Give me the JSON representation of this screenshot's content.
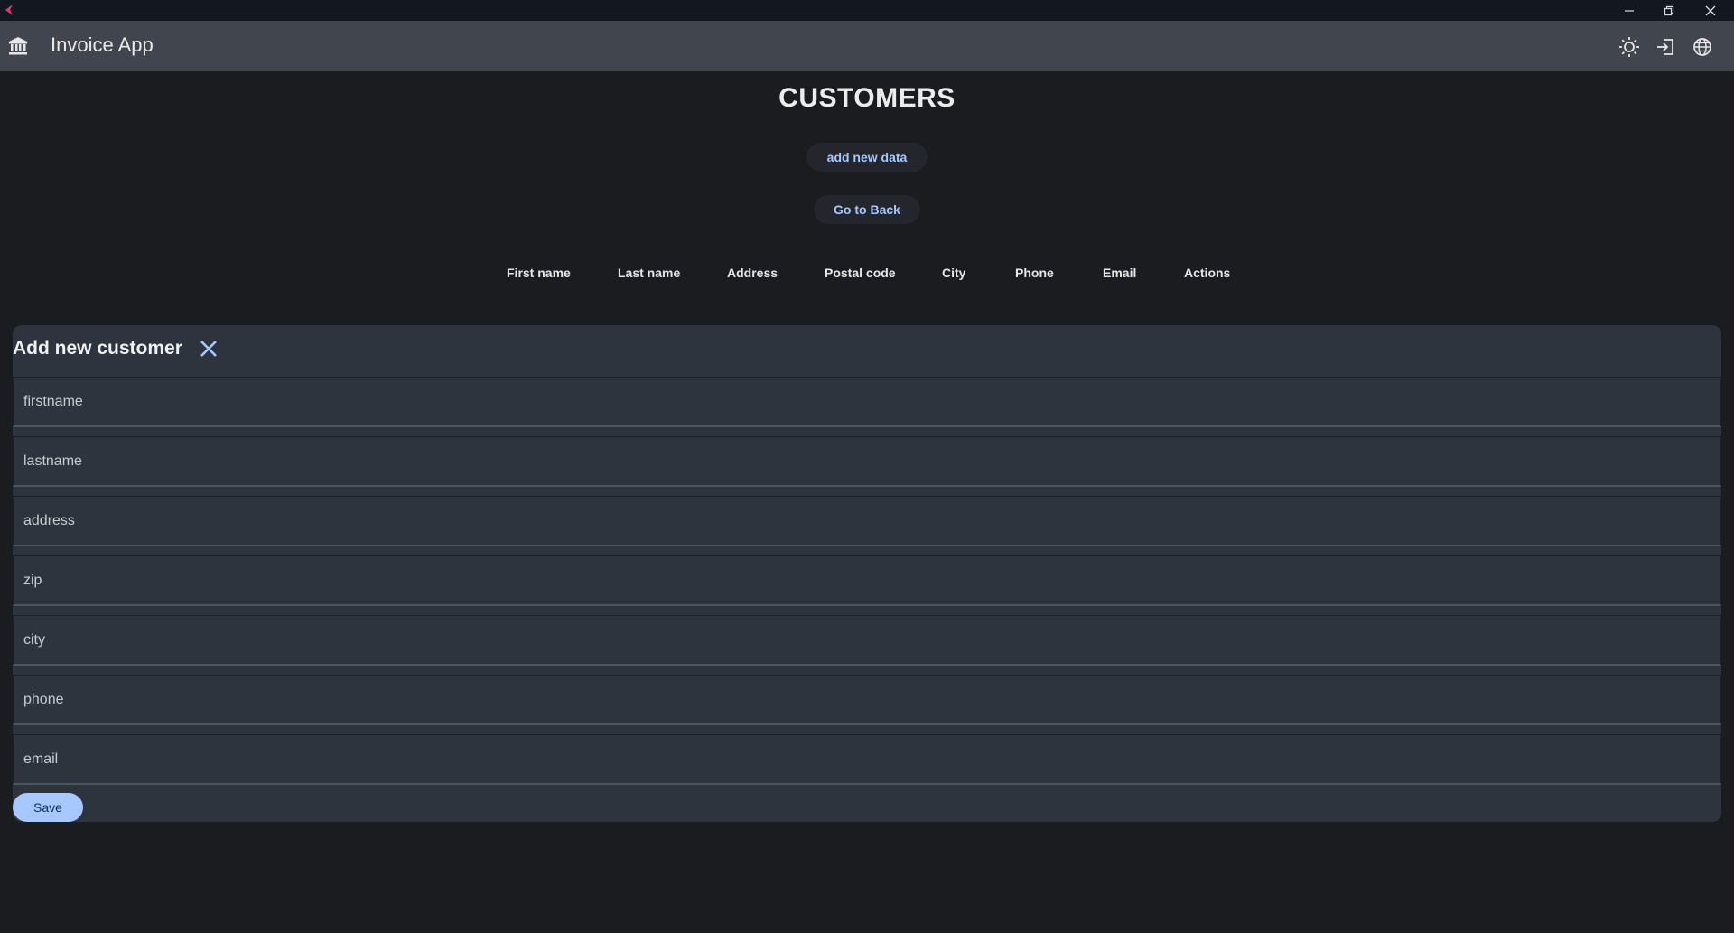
{
  "app": {
    "title": "Invoice App",
    "accent_color": "#a6c8ff",
    "header_icons": [
      "bank-icon",
      "sun-icon",
      "logout-icon",
      "globe-icon"
    ]
  },
  "window": {
    "controls": [
      "minimize-icon",
      "restore-icon",
      "close-icon"
    ]
  },
  "page": {
    "title": "CUSTOMERS",
    "add_button": "add new data",
    "back_button": "Go to Back"
  },
  "table": {
    "columns": [
      "First name",
      "Last name",
      "Address",
      "Postal code",
      "City",
      "Phone",
      "Email",
      "Actions"
    ]
  },
  "form": {
    "title": "Add new customer",
    "fields": [
      {
        "placeholder": "firstname",
        "value": ""
      },
      {
        "placeholder": "lastname",
        "value": ""
      },
      {
        "placeholder": "address",
        "value": ""
      },
      {
        "placeholder": "zip",
        "value": ""
      },
      {
        "placeholder": "city",
        "value": ""
      },
      {
        "placeholder": "phone",
        "value": ""
      },
      {
        "placeholder": "email",
        "value": ""
      }
    ],
    "save_label": "Save"
  }
}
